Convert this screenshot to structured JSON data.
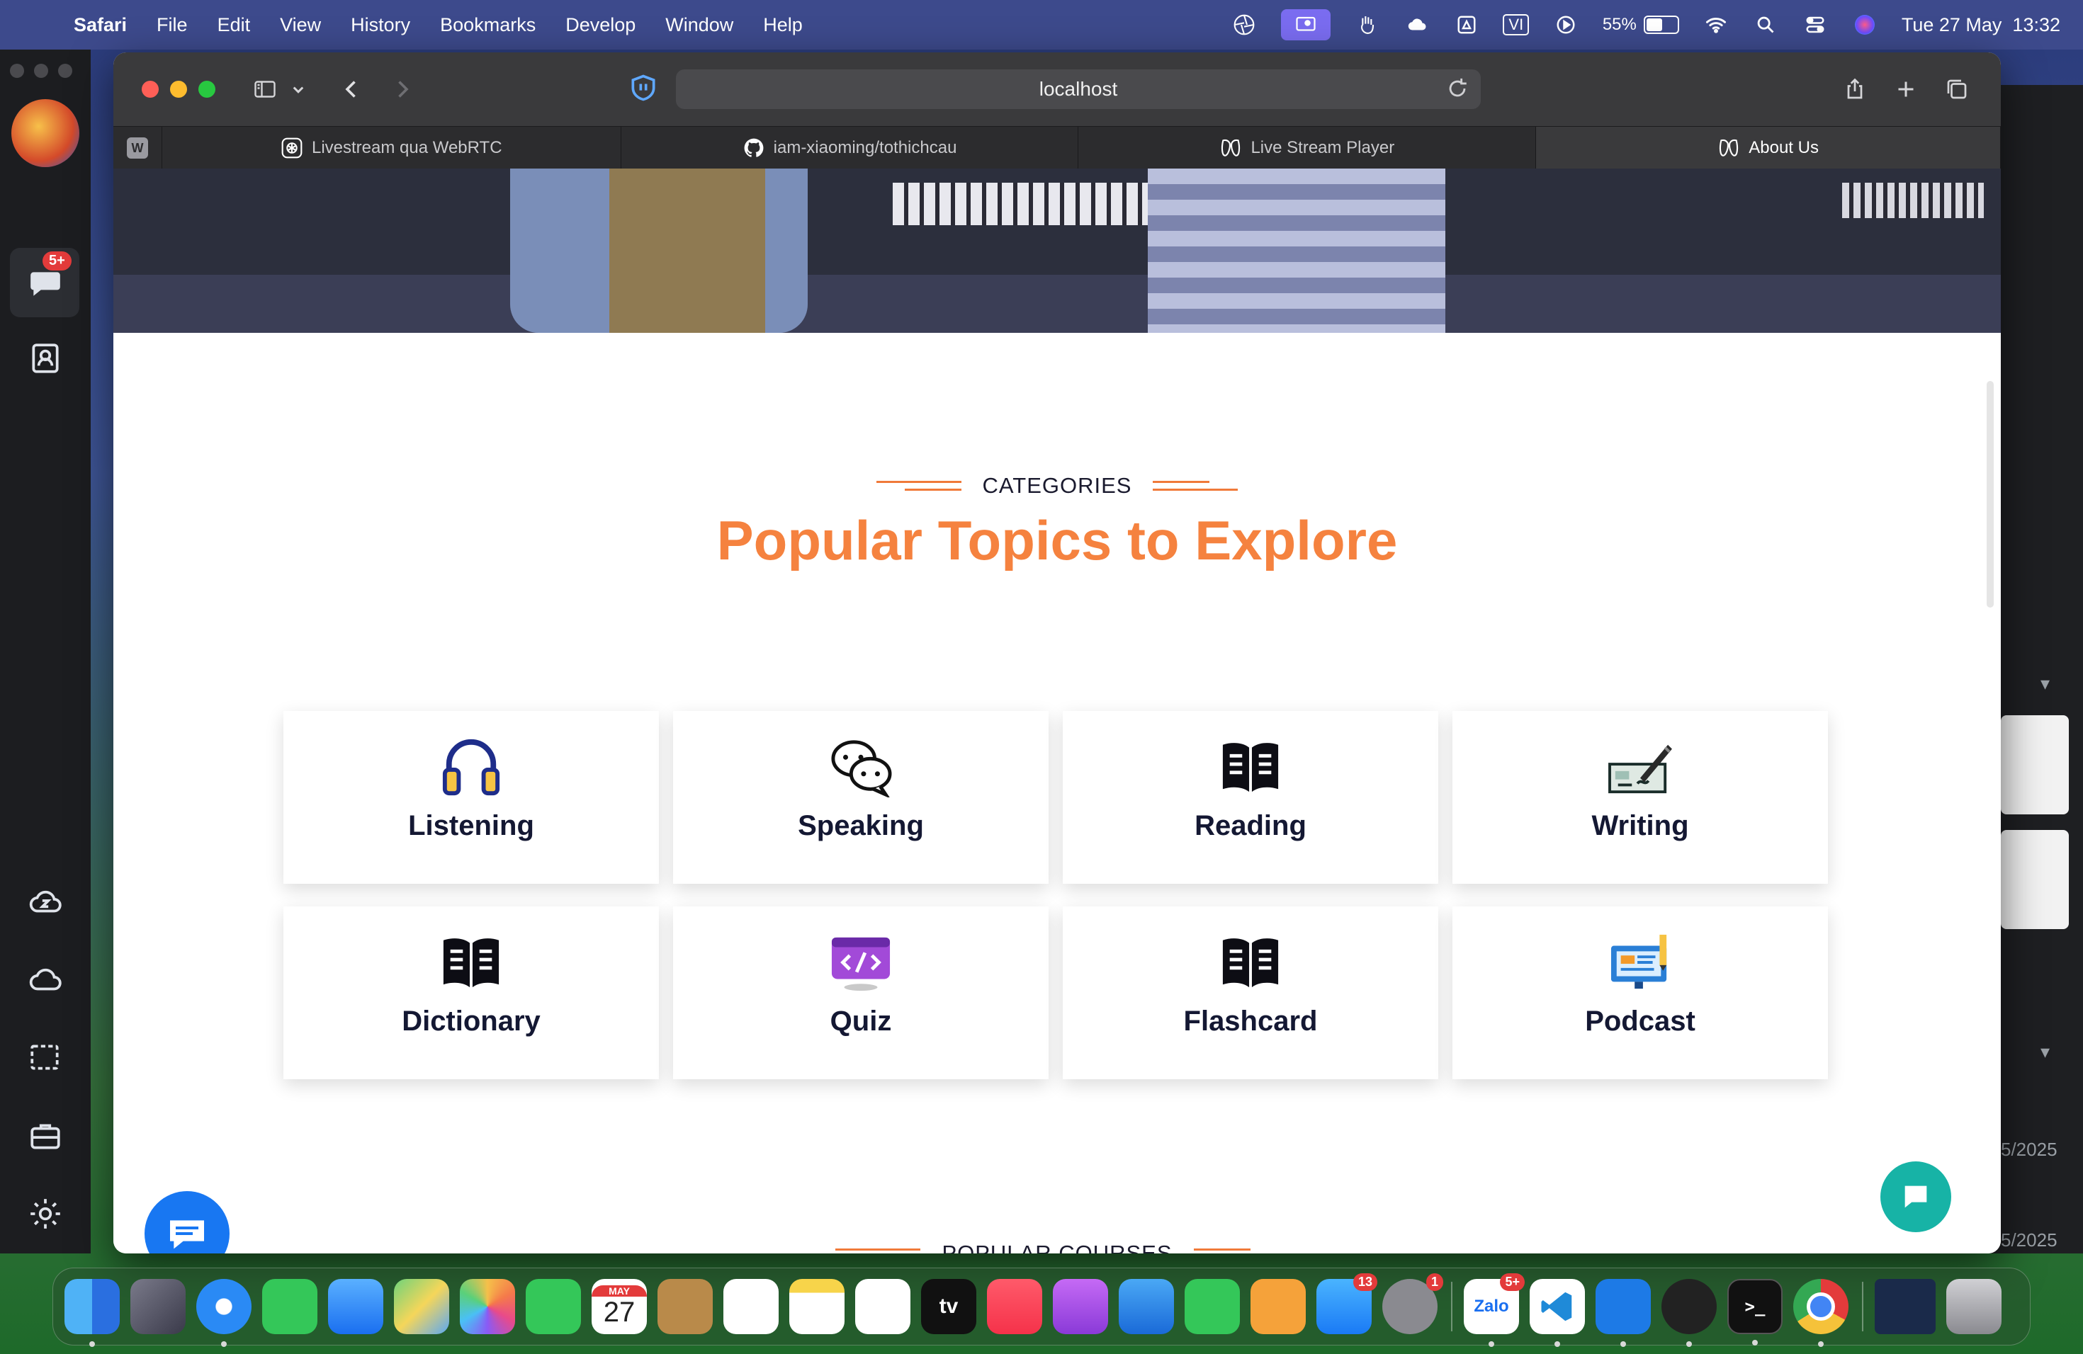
{
  "menubar": {
    "app": "Safari",
    "items": [
      "File",
      "Edit",
      "View",
      "History",
      "Bookmarks",
      "Develop",
      "Window",
      "Help"
    ],
    "battery": "55%",
    "battery_level": 0.55,
    "clock": "Tue 27 May  13:32",
    "input_source": "VI"
  },
  "messaging": {
    "badge": "5+"
  },
  "background_window": {
    "dates": [
      "5/2025",
      "5/2025"
    ]
  },
  "browser": {
    "url": "localhost",
    "tabs": [
      {
        "label": "",
        "icon": "W"
      },
      {
        "label": "Livestream qua WebRTC",
        "icon": "openai-icon"
      },
      {
        "label": "iam-xiaoming/tothichcau",
        "icon": "github-icon"
      },
      {
        "label": "Live Stream Player",
        "icon": "mask-icon"
      },
      {
        "label": "About Us",
        "icon": "mask-icon"
      }
    ]
  },
  "page": {
    "categories_tag": "CATEGORIES",
    "title": "Popular Topics to Explore",
    "categories": [
      {
        "label": "Listening",
        "icon": "headphones-icon"
      },
      {
        "label": "Speaking",
        "icon": "chat-bubbles-icon"
      },
      {
        "label": "Reading",
        "icon": "open-book-icon"
      },
      {
        "label": "Writing",
        "icon": "pen-signature-icon"
      },
      {
        "label": "Dictionary",
        "icon": "open-book-icon"
      },
      {
        "label": "Quiz",
        "icon": "code-screen-icon"
      },
      {
        "label": "Flashcard",
        "icon": "open-book-icon"
      },
      {
        "label": "Podcast",
        "icon": "monitor-pencil-icon"
      }
    ],
    "courses_tag": "POPULAR COURSES"
  },
  "dock": {
    "calendar_month": "MAY",
    "calendar_day": "27",
    "badges": {
      "appstore": "13",
      "settings": "1",
      "zalo": "5+"
    },
    "zalo_label": "Zalo",
    "tv_label": "tv"
  },
  "colors": {
    "accent_orange": "#f5823f",
    "heading_dark": "#141833",
    "messenger_blue": "#1877f2",
    "chat_teal": "#17b3a6"
  }
}
